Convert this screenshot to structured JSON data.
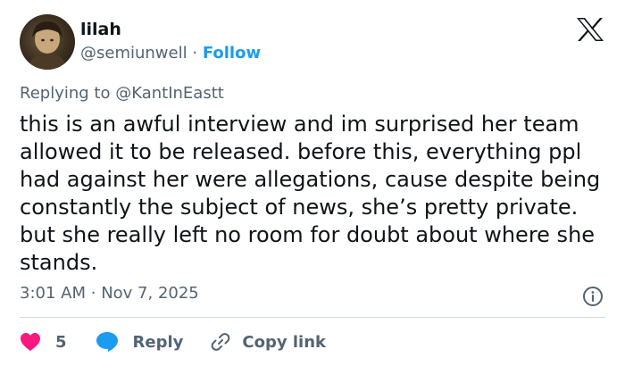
{
  "author": {
    "name": "lilah",
    "handle": "@semiunwell",
    "separator": "·",
    "follow_label": "Follow"
  },
  "reply_to": {
    "prefix": "Replying to",
    "handle": "@KantInEastt"
  },
  "tweet": {
    "text": "this is an awful interview and im surprised her team allowed it to be released. before this, everything ppl had against her were allegations, cause despite being constantly the subject of news, she’s pretty private. but she really left no room for doubt about where she stands.",
    "time": "3:01 AM",
    "separator": "·",
    "date": "Nov 7, 2025"
  },
  "actions": {
    "like_count": "5",
    "reply_label": "Reply",
    "copy_label": "Copy link"
  },
  "colors": {
    "like": "#f91880",
    "reply": "#1d9bf0",
    "link": "#1d9bf0",
    "muted": "#536471",
    "text": "#0f1419"
  },
  "icons": [
    "x-logo-icon",
    "heart-icon",
    "reply-bubble-icon",
    "link-icon",
    "info-icon"
  ]
}
